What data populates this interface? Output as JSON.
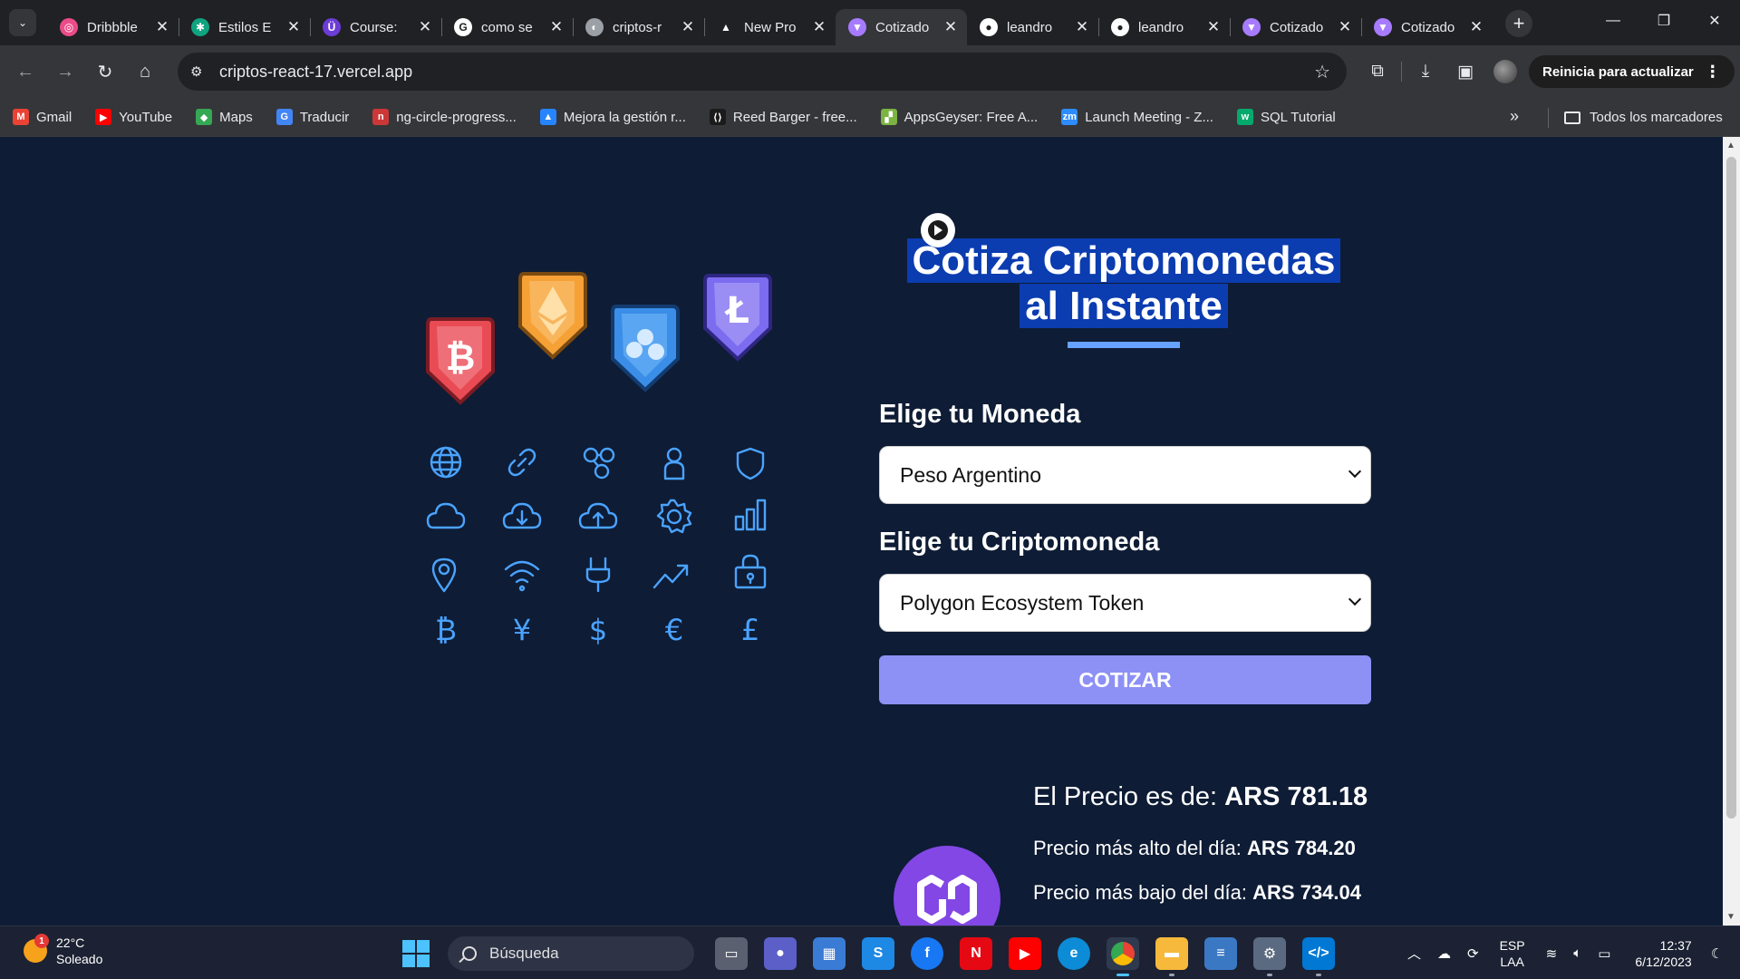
{
  "browser": {
    "tabs": [
      {
        "title": "Dribbble",
        "favicon_color": "#ea4c89",
        "favicon_glyph": "◎",
        "active": false
      },
      {
        "title": "Estilos E",
        "favicon_color": "#10a37f",
        "favicon_glyph": "✱",
        "active": false
      },
      {
        "title": "Course:",
        "favicon_color": "#6c3cd6",
        "favicon_glyph": "Ü",
        "active": false
      },
      {
        "title": "como se",
        "favicon_color": "#ffffff",
        "favicon_glyph": "G",
        "active": false
      },
      {
        "title": "criptos-r",
        "favicon_color": "#9aa0a6",
        "favicon_glyph": "◐",
        "active": false
      },
      {
        "title": "New Pro",
        "favicon_color": "#202124",
        "favicon_glyph": "▲",
        "active": false
      },
      {
        "title": "Cotizado",
        "favicon_color": "#a77bff",
        "favicon_glyph": "▼",
        "active": true
      },
      {
        "title": "leandro",
        "favicon_color": "#ffffff",
        "favicon_glyph": "●",
        "active": false
      },
      {
        "title": "leandro",
        "favicon_color": "#ffffff",
        "favicon_glyph": "●",
        "active": false
      },
      {
        "title": "Cotizado",
        "favicon_color": "#a77bff",
        "favicon_glyph": "▼",
        "active": false
      },
      {
        "title": "Cotizado",
        "favicon_color": "#a77bff",
        "favicon_glyph": "▼",
        "active": false
      }
    ],
    "url": "criptos-react-17.vercel.app",
    "update_label": "Reinicia para actualizar",
    "bookmarks": [
      {
        "label": "Gmail",
        "icon": "gmail-icon",
        "color": "#ea4335",
        "glyph": "M"
      },
      {
        "label": "YouTube",
        "icon": "youtube-icon",
        "color": "#ff0000",
        "glyph": "▶"
      },
      {
        "label": "Maps",
        "icon": "maps-icon",
        "color": "#34a853",
        "glyph": "◆"
      },
      {
        "label": "Traducir",
        "icon": "translate-icon",
        "color": "#4285f4",
        "glyph": "G"
      },
      {
        "label": "ng-circle-progress...",
        "icon": "npm-icon",
        "color": "#cb3837",
        "glyph": "n"
      },
      {
        "label": "Mejora la gestión r...",
        "icon": "atlassian-icon",
        "color": "#2684ff",
        "glyph": "▲"
      },
      {
        "label": "Reed Barger - free...",
        "icon": "reed-icon",
        "color": "#1b1b1b",
        "glyph": "⟨⟩"
      },
      {
        "label": "AppsGeyser: Free A...",
        "icon": "appsgeyser-icon",
        "color": "#7cb342",
        "glyph": "▞"
      },
      {
        "label": "Launch Meeting - Z...",
        "icon": "zoom-icon",
        "color": "#2d8cff",
        "glyph": "zm"
      },
      {
        "label": "SQL Tutorial",
        "icon": "w3schools-icon",
        "color": "#04aa6d",
        "glyph": "w"
      }
    ],
    "all_bookmarks_label": "Todos los marcadores"
  },
  "app": {
    "title": "Cotiza Criptomonedas al Instante",
    "currency_label": "Elige tu Moneda",
    "currency_value": "Peso Argentino",
    "crypto_label": "Elige tu Criptomoneda",
    "crypto_value": "Polygon Ecosystem Token",
    "submit_label": "COTIZAR",
    "price_prefix": "El Precio es de: ",
    "price_value": "ARS 781.18",
    "high_prefix": "Precio más alto del día: ",
    "high_value": "ARS 784.20",
    "low_prefix": "Precio más bajo del día: ",
    "low_value": "ARS 734.04",
    "accent_color": "#8d90f5",
    "heading_highlight": "#0b3cb0",
    "underline_color": "#66a2fe",
    "background": "#0e1c35",
    "coin_color": "#8247e5"
  },
  "taskbar": {
    "temperature": "22°C",
    "weather": "Soleado",
    "weather_badge": "1",
    "search_placeholder": "Búsqueda",
    "language": "ESP",
    "layout": "LAA",
    "time": "12:37",
    "date": "6/12/2023"
  }
}
